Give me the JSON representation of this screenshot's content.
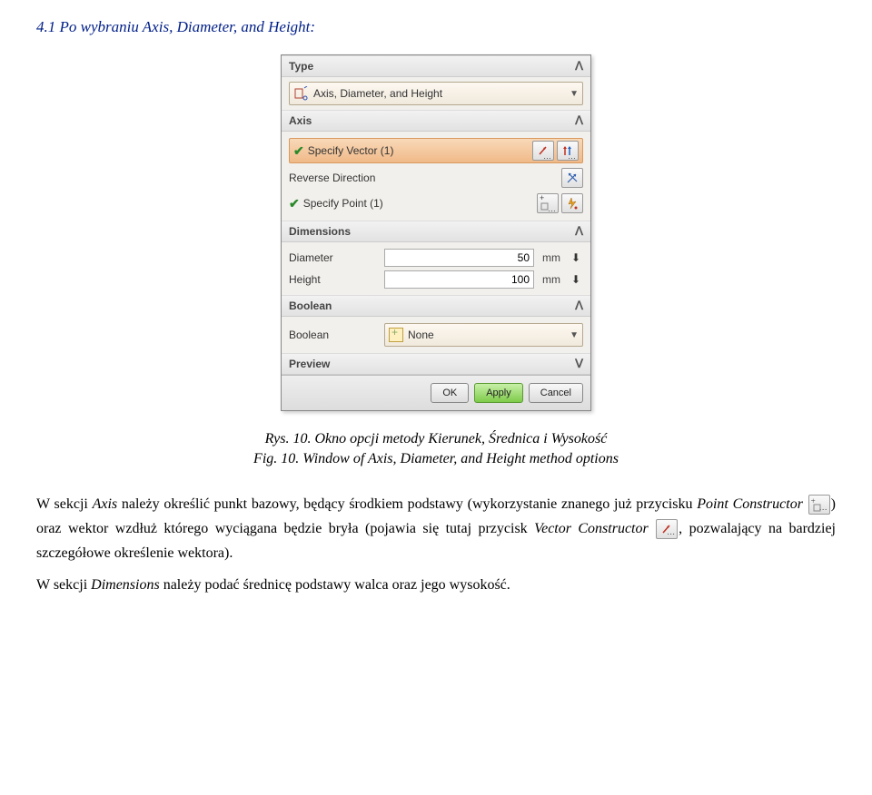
{
  "heading": "4.1 Po wybraniu Axis, Diameter, and Height:",
  "dialog": {
    "type": {
      "label": "Type",
      "value": "Axis, Diameter, and Height"
    },
    "axis": {
      "label": "Axis",
      "specifyVector": "Specify Vector (1)",
      "reverse": "Reverse Direction",
      "specifyPoint": "Specify Point (1)"
    },
    "dimensions": {
      "label": "Dimensions",
      "diameter": {
        "label": "Diameter",
        "value": "50",
        "unit": "mm"
      },
      "height": {
        "label": "Height",
        "value": "100",
        "unit": "mm"
      }
    },
    "boolean": {
      "label": "Boolean",
      "field": "Boolean",
      "value": "None"
    },
    "preview": {
      "label": "Preview"
    },
    "ok": "OK",
    "apply": "Apply",
    "cancel": "Cancel"
  },
  "caption_pl": "Rys. 10. Okno opcji metody Kierunek, Średnica i Wysokość",
  "caption_en": "Fig. 10. Window of Axis, Diameter, and Height method options",
  "para1_a": "W sekcji ",
  "para1_b": "Axis",
  "para1_c": " należy określić punkt bazowy, będący środkiem podstawy (wykorzystanie znanego już przycisku ",
  "para1_d": "Point Constructor",
  "para1_e": ") oraz wektor wzdłuż którego wyciągana będzie bryła (pojawia się tutaj przycisk ",
  "para1_f": "Vector Constructor",
  "para1_g": ", pozwalający na bardziej szczegółowe określenie wektora).",
  "para2_a": "W sekcji ",
  "para2_b": "Dimensions",
  "para2_c": " należy podać średnicę podstawy walca oraz jego wysokość."
}
